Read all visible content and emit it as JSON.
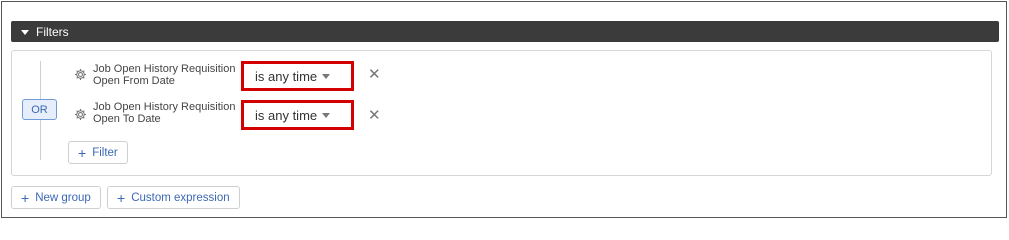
{
  "filters": {
    "title": "Filters",
    "group": {
      "operator": "OR",
      "rows": [
        {
          "label_line1": "Job Open History Requisition",
          "label_line2": "Open From Date",
          "condition": "is any time"
        },
        {
          "label_line1": "Job Open History Requisition",
          "label_line2": "Open To Date",
          "condition": "is any time"
        }
      ],
      "add_filter_label": "Filter"
    },
    "new_group_label": "New group",
    "custom_expression_label": "Custom expression"
  },
  "icons": {
    "caret": "chevron-down-icon",
    "gear": "gear-icon",
    "remove": "close-icon",
    "add": "plus-icon"
  },
  "colors": {
    "header_bg": "#3b3b3b",
    "highlight_border": "#d40000",
    "accent_blue": "#3c68b5",
    "or_badge_bg": "#e6eefb"
  }
}
